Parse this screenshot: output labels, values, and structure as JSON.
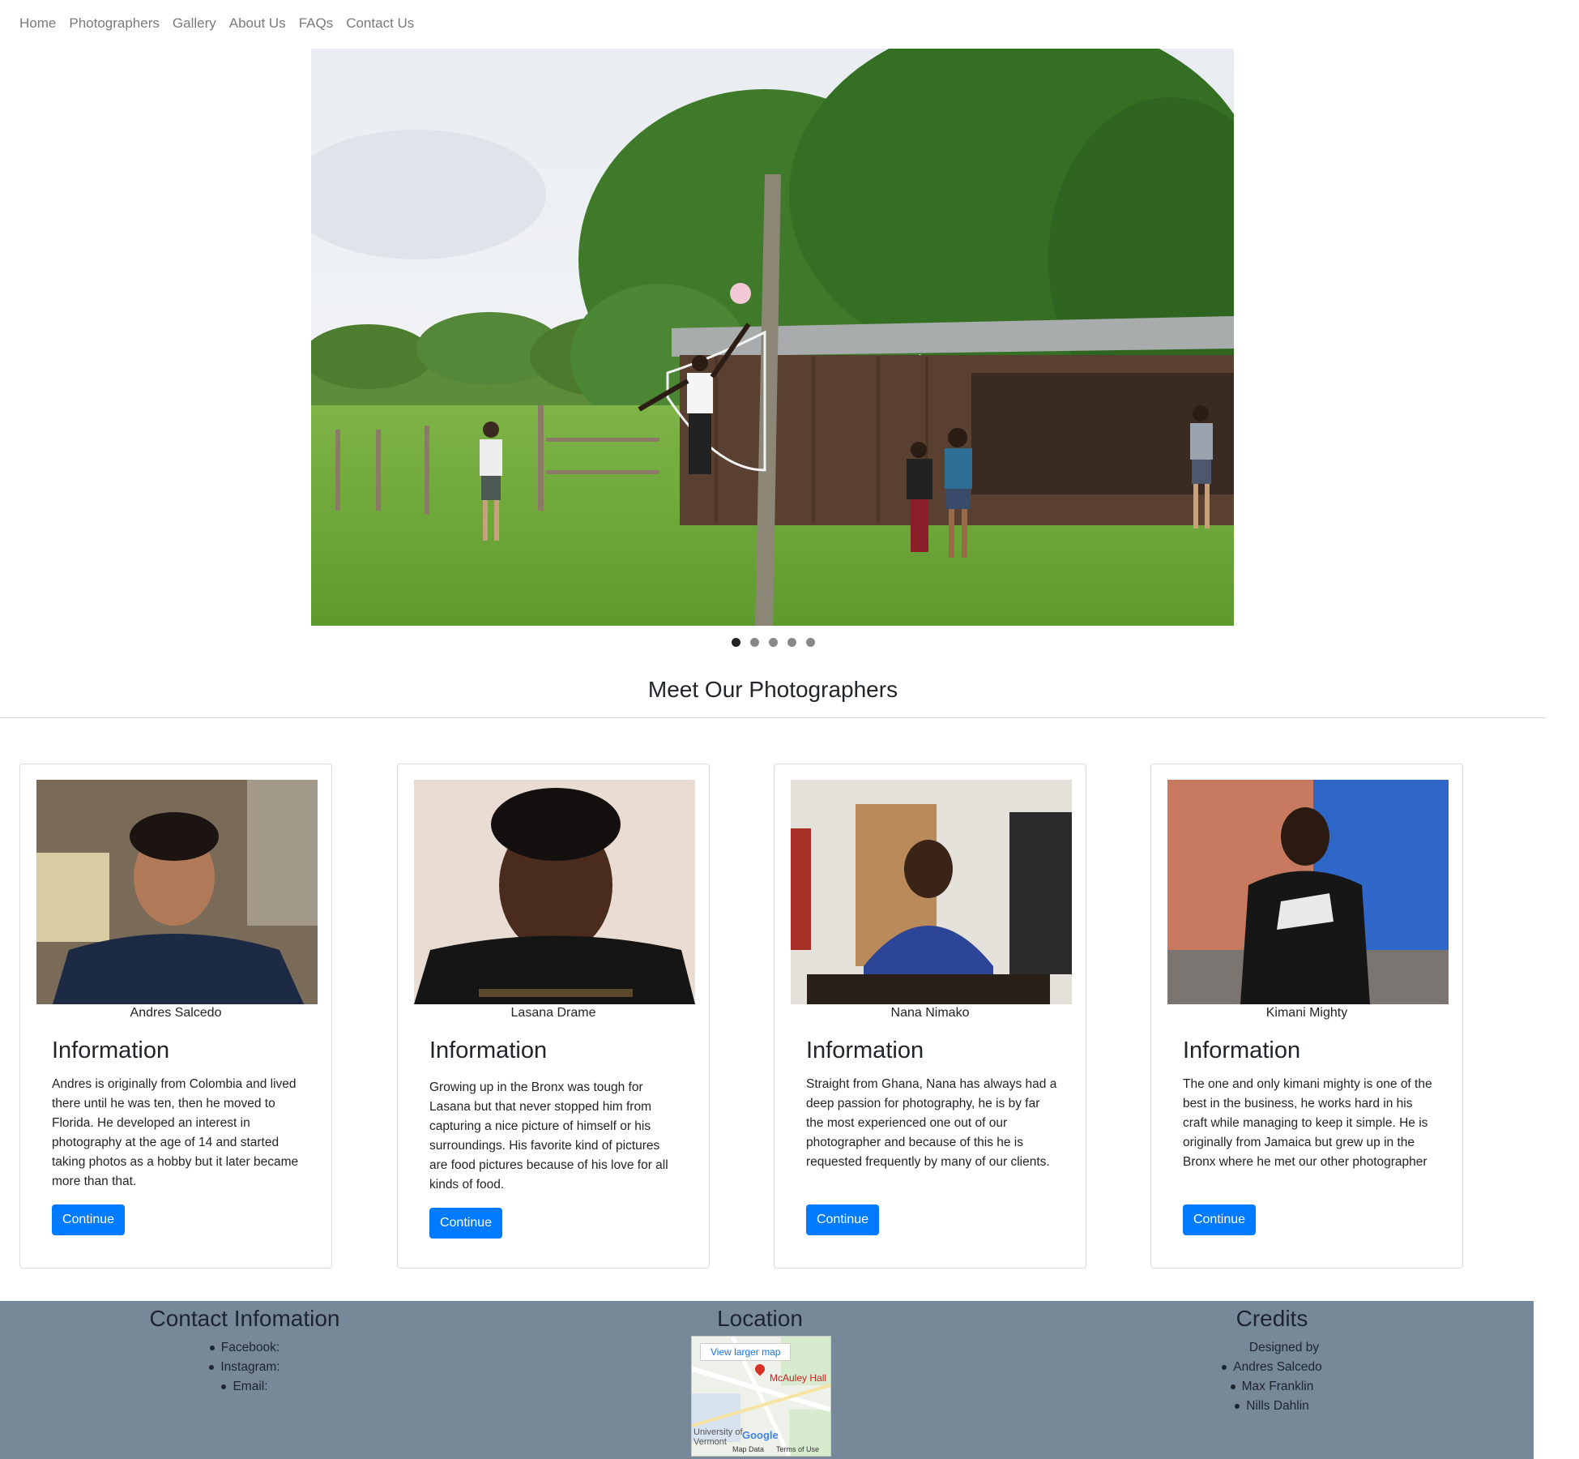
{
  "nav": {
    "items": [
      "Home",
      "Photographers",
      "Gallery",
      "About Us",
      "FAQs",
      "Contact Us"
    ]
  },
  "carousel": {
    "slides": 5,
    "active_index": 0
  },
  "section": {
    "title": "Meet Our Photographers"
  },
  "photographers": [
    {
      "name": "Andres Salcedo",
      "heading": "Information",
      "bio": "Andres is originally from Colombia and lived there until he was ten, then he moved to Florida. He developed an interest in photography at the age of 14 and started taking photos as a hobby but it later became more than that.",
      "button": "Continue"
    },
    {
      "name": "Lasana Drame",
      "heading": "Information",
      "bio": "Growing up in the Bronx was tough for Lasana but that never stopped him from capturing a nice picture of himself or his surroundings. His favorite kind of pictures are food pictures because of his love for all kinds of food.",
      "button": "Continue"
    },
    {
      "name": "Nana Nimako",
      "heading": "Information",
      "bio": "Straight from Ghana, Nana has always had a deep passion for photography, he is by far the most experienced one out of our photographer and because of this he is requested frequently by many of our clients.",
      "button": "Continue"
    },
    {
      "name": "Kimani Mighty",
      "heading": "Information",
      "bio": "The one and only kimani mighty is one of the best in the business, he works hard in his craft while managing to keep it simple. He is originally from Jamaica but grew up in the Bronx where he met our other photographer",
      "button": "Continue"
    }
  ],
  "footer": {
    "contact": {
      "title": "Contact Infomation",
      "items": [
        "Facebook:",
        "Instagram:",
        "Email:"
      ]
    },
    "location": {
      "title": "Location",
      "map_link": "View larger map",
      "place": "McAuley Hall",
      "area": "University of Vermont",
      "brand": "Google",
      "map_data": "Map Data",
      "terms": "Terms of Use"
    },
    "credits": {
      "title": "Credits",
      "intro": "Designed by",
      "names": [
        "Andres Salcedo",
        "Max Franklin",
        "Nills Dahlin"
      ]
    }
  },
  "colors": {
    "accent": "#007bff",
    "footer_bg": "#778899",
    "nav_text": "#7a7a7a"
  }
}
